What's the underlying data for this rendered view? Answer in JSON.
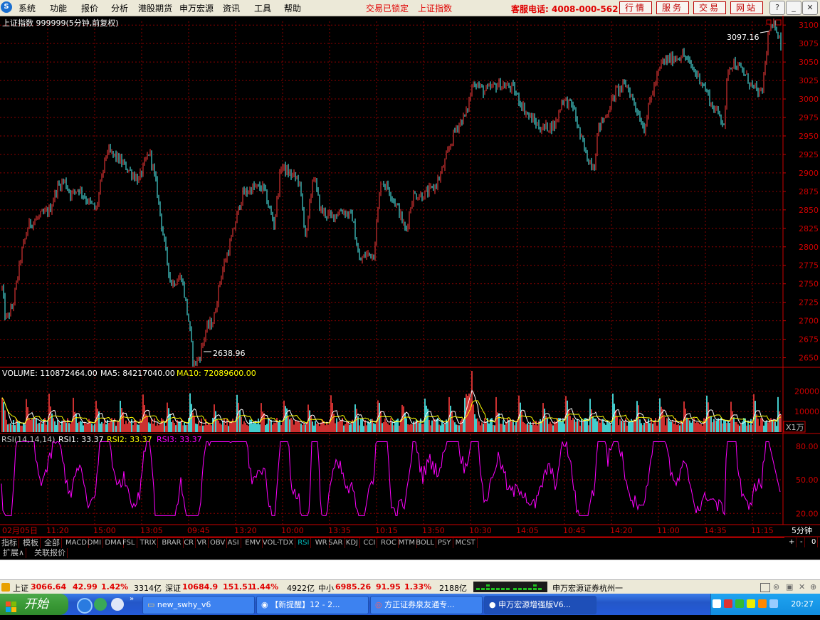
{
  "menubar": {
    "items": [
      "系统",
      "功能",
      "报价",
      "分析",
      "港股期货",
      "申万宏源",
      "资讯",
      "工具",
      "帮助"
    ],
    "status_locked": "交易已锁定",
    "status_index": "上证指数",
    "hotline": "客服电话: 4008-000-562",
    "buttons": [
      "行情",
      "服务",
      "交易",
      "网站"
    ],
    "window_controls": [
      "help-icon",
      "minimize-icon",
      "restore-icon",
      "close-icon"
    ]
  },
  "chart_header": {
    "title": "上证指数 999999(5分钟,前复权)"
  },
  "colors": {
    "up": "#ff3c3c",
    "down": "#54ffff",
    "grid": "#8b0000",
    "ma5": "#ffffff",
    "ma10": "#ffff00",
    "rsi": "#ff00ff"
  },
  "chart_data": [
    {
      "type": "candlestick",
      "title": "上证指数 999999(5分钟,前复权)",
      "ylim": [
        2638,
        3105
      ],
      "y_ticks": [
        2650,
        2675,
        2700,
        2725,
        2750,
        2775,
        2800,
        2825,
        2850,
        2875,
        2900,
        2925,
        2950,
        2975,
        3000,
        3025,
        3050,
        3075,
        3100
      ],
      "high_label": "3097.16",
      "low_label": "2638.96",
      "path": [
        [
          0,
          2770
        ],
        [
          8,
          2700
        ],
        [
          18,
          2720
        ],
        [
          30,
          2790
        ],
        [
          40,
          2830
        ],
        [
          55,
          2840
        ],
        [
          70,
          2850
        ],
        [
          80,
          2880
        ],
        [
          90,
          2890
        ],
        [
          100,
          2870
        ],
        [
          110,
          2880
        ],
        [
          125,
          2860
        ],
        [
          135,
          2850
        ],
        [
          150,
          2930
        ],
        [
          165,
          2920
        ],
        [
          180,
          2905
        ],
        [
          195,
          2890
        ],
        [
          210,
          2930
        ],
        [
          220,
          2880
        ],
        [
          230,
          2810
        ],
        [
          240,
          2750
        ],
        [
          255,
          2760
        ],
        [
          265,
          2700
        ],
        [
          272,
          2640
        ],
        [
          280,
          2650
        ],
        [
          290,
          2690
        ],
        [
          300,
          2700
        ],
        [
          310,
          2760
        ],
        [
          325,
          2810
        ],
        [
          340,
          2870
        ],
        [
          355,
          2880
        ],
        [
          370,
          2880
        ],
        [
          385,
          2830
        ],
        [
          395,
          2910
        ],
        [
          405,
          2900
        ],
        [
          420,
          2890
        ],
        [
          430,
          2810
        ],
        [
          440,
          2900
        ],
        [
          450,
          2850
        ],
        [
          465,
          2840
        ],
        [
          480,
          2850
        ],
        [
          495,
          2840
        ],
        [
          505,
          2780
        ],
        [
          515,
          2790
        ],
        [
          525,
          2790
        ],
        [
          535,
          2890
        ],
        [
          545,
          2880
        ],
        [
          560,
          2850
        ],
        [
          570,
          2820
        ],
        [
          580,
          2870
        ],
        [
          595,
          2870
        ],
        [
          610,
          2880
        ],
        [
          620,
          2900
        ],
        [
          630,
          2930
        ],
        [
          640,
          2960
        ],
        [
          655,
          2980
        ],
        [
          665,
          3025
        ],
        [
          680,
          3010
        ],
        [
          700,
          3020
        ],
        [
          720,
          3015
        ],
        [
          740,
          2980
        ],
        [
          760,
          2960
        ],
        [
          780,
          2965
        ],
        [
          790,
          3000
        ],
        [
          805,
          2990
        ],
        [
          815,
          2950
        ],
        [
          825,
          2920
        ],
        [
          835,
          2910
        ],
        [
          840,
          2960
        ],
        [
          850,
          2975
        ],
        [
          865,
          3010
        ],
        [
          880,
          3020
        ],
        [
          895,
          2985
        ],
        [
          905,
          2960
        ],
        [
          915,
          3005
        ],
        [
          930,
          3050
        ],
        [
          945,
          3055
        ],
        [
          960,
          3060
        ],
        [
          970,
          3045
        ],
        [
          985,
          3025
        ],
        [
          995,
          3005
        ],
        [
          1000,
          2990
        ],
        [
          1010,
          2980
        ],
        [
          1018,
          2965
        ],
        [
          1022,
          3040
        ],
        [
          1030,
          3050
        ],
        [
          1045,
          3035
        ],
        [
          1058,
          3015
        ],
        [
          1070,
          3005
        ],
        [
          1074,
          3040
        ],
        [
          1080,
          3092
        ],
        [
          1090,
          3100
        ],
        [
          1098,
          3070
        ]
      ]
    },
    {
      "type": "bar",
      "title": "VOLUME",
      "ylabel": "X1万",
      "ylim": [
        0,
        25000
      ],
      "y_ticks": [
        10000,
        20000
      ],
      "summary": {
        "volume": "110872464.00",
        "ma5": "84217040.00",
        "ma10": "72089600.00"
      }
    },
    {
      "type": "line",
      "title": "RSI(14,14,14)",
      "ylim": [
        10,
        90
      ],
      "y_ticks": [
        20,
        50,
        80
      ],
      "series": [
        {
          "name": "RSI1",
          "value": "33.37"
        },
        {
          "name": "RSI2",
          "value": "33.37"
        },
        {
          "name": "RSI3",
          "value": "33.37"
        }
      ]
    }
  ],
  "panels": {
    "volume_label": "VOLUME: 110872464.00",
    "ma5_label": "MA5: 84217040.00",
    "ma10_label": "MA10: 72089600.00",
    "rsi_label": "RSI(14,14,14)",
    "rsi1_label": "RSI1: 33.37",
    "rsi2_label": "RSI2: 33.37",
    "rsi3_label": "RSI3: 33.37",
    "unit_label": "X1万",
    "period_label": "5分钟"
  },
  "time_axis": [
    "02月05日",
    "11:20",
    "15:00",
    "13:05",
    "09:45",
    "13:20",
    "10:00",
    "13:35",
    "10:15",
    "13:50",
    "10:30",
    "14:05",
    "10:45",
    "14:20",
    "11:00",
    "14:35",
    "11:15"
  ],
  "indicator_tabs": [
    "指标",
    "模板",
    "全部",
    "MACD",
    "DMI",
    "DMA",
    "FSL",
    "TRIX",
    "BRAR",
    "CR",
    "VR",
    "OBV",
    "ASI",
    "EMV",
    "VOL-TDX",
    "RSI",
    "WR",
    "SAR",
    "KDJ",
    "CCI",
    "ROC",
    "MTM",
    "BOLL",
    "PSY",
    "MCST"
  ],
  "tab_controls": [
    "+",
    "-",
    "0"
  ],
  "lower_tabs": [
    "扩展∧",
    "关联报价"
  ],
  "statusbar": {
    "sh_name": "上证",
    "sh_value": "3066.64",
    "sh_change": "42.99",
    "sh_pct": "1.42%",
    "sh_amount": "3314亿",
    "sz_name": "深证",
    "sz_value": "10684.9",
    "sz_change": "151.51",
    "sz_pct": "1.44%",
    "sz_amount": "4922亿",
    "zx_name": "中小",
    "zx_value": "6985.26",
    "zx_change": "91.95",
    "zx_pct": "1.33%",
    "zx_amount": "2188亿",
    "broker": "申万宏源证券杭州一"
  },
  "taskbar": {
    "start": "开始",
    "tasks": [
      "new_swhy_v6",
      "【新提醒】12 - 2...",
      "方正证券泉友通专...",
      "申万宏源增强版V6..."
    ],
    "clock": "20:27"
  }
}
